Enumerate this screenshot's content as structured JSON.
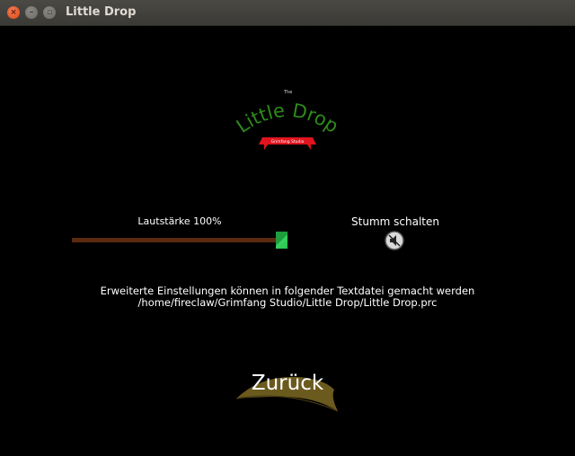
{
  "window": {
    "title": "Little Drop",
    "close_glyph": "×",
    "min_glyph": "–",
    "max_glyph": "▫"
  },
  "logo": {
    "the_text": "The",
    "name": "Little Drop",
    "ribbon": "Grimfang Studio",
    "color": "#2e8a1c",
    "ribbon_color": "#e0141f"
  },
  "volume": {
    "label": "Lautstärke 100%",
    "level_percent": 100,
    "track_color": "#5a2a10",
    "thumb_color": "#27c24f"
  },
  "mute": {
    "label": "Stumm schalten",
    "icon": "speaker-icon"
  },
  "info": {
    "line1": "Erweiterte Einstellungen können in folgender Textdatei gemacht werden",
    "line2": "/home/fireclaw/Grimfang Studio/Little Drop/Little Drop.prc"
  },
  "back": {
    "label": "Zurück",
    "leaf_color": "#6b5a1e"
  }
}
